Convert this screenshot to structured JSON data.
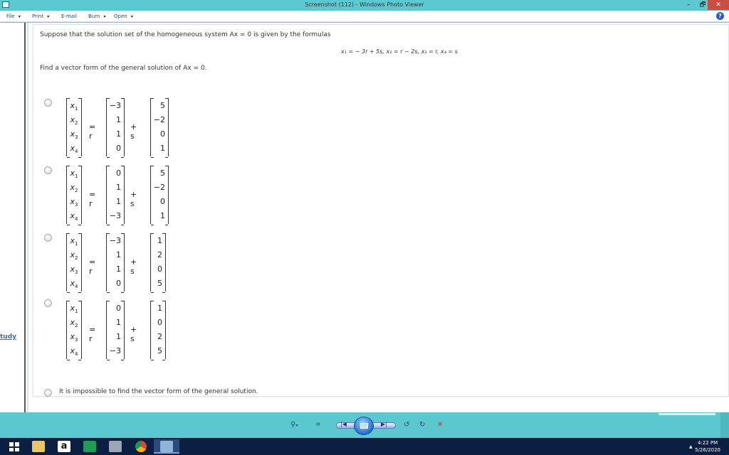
{
  "window": {
    "title": "Screenshot (112) - Windows Photo Viewer",
    "min": "–",
    "max": "🗗",
    "close": "✕"
  },
  "menu": {
    "file": "File",
    "print": "Print",
    "email": "E-mail",
    "burn": "Burn",
    "open": "Open",
    "arrow": "▾",
    "help": "?"
  },
  "problem": {
    "line1": "Suppose that the solution set of the homogeneous system Ax = 0 is given by the formulas",
    "formula": "x₁ = − 3r + 5s, x₂ = r − 2s, x₃ = r, x₄ = s",
    "line2": "Find a vector form of the general solution of Ax = 0."
  },
  "symbols": {
    "eq": "= r",
    "plus": "+ s"
  },
  "vars": [
    "x",
    "x",
    "x",
    "x"
  ],
  "subs": [
    "1",
    "2",
    "3",
    "4"
  ],
  "options": [
    {
      "r": [
        "−3",
        "1",
        "1",
        "0"
      ],
      "s": [
        "5",
        "−2",
        "0",
        "1"
      ]
    },
    {
      "r": [
        "0",
        "1",
        "1",
        "−3"
      ],
      "s": [
        "5",
        "−2",
        "0",
        "1"
      ]
    },
    {
      "r": [
        "−3",
        "1",
        "1",
        "0"
      ],
      "s": [
        "1",
        "2",
        "0",
        "5"
      ]
    },
    {
      "r": [
        "0",
        "1",
        "1",
        "−3"
      ],
      "s": [
        "1",
        "0",
        "2",
        "5"
      ]
    }
  ],
  "last_option": "It is impossible to find the vector form of the general solution.",
  "side_fragment": "tudy",
  "controls": {
    "zoom": "⚲",
    "zoom_arrow": "▾",
    "fit": "⌗",
    "prev": "|◀",
    "next": "▶|",
    "rot_ccw": "↺",
    "rot_cw": "↻",
    "delete": "✕"
  },
  "taskbar": {
    "amazon": "a",
    "time": "4:22 PM",
    "date": "5/26/2020",
    "tray_arrow": "▲"
  },
  "colors": {
    "titlebar": "#5cc9d1",
    "taskbar": "#0a1f42",
    "close": "#c94e3f"
  }
}
